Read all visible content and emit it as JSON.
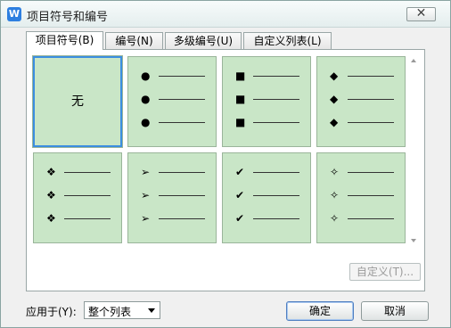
{
  "window": {
    "title": "项目符号和编号",
    "app_icon": "W",
    "close_glyph": "✕"
  },
  "tabs": [
    {
      "label": "项目符号(B)",
      "active": true
    },
    {
      "label": "编号(N)",
      "active": false
    },
    {
      "label": "多级编号(U)",
      "active": false
    },
    {
      "label": "自定义列表(L)",
      "active": false
    }
  ],
  "bullets": {
    "none_label": "无",
    "tile_color": "#c9e6c7",
    "selected_color": "#3b8ee0",
    "styles": [
      {
        "icon": "none",
        "glyph": "",
        "selected": true
      },
      {
        "icon": "filled-circle-icon",
        "glyph": "●"
      },
      {
        "icon": "filled-square-icon",
        "glyph": "■"
      },
      {
        "icon": "filled-diamond-icon",
        "glyph": "◆"
      },
      {
        "icon": "four-diamond-icon",
        "glyph": "❖"
      },
      {
        "icon": "arrowhead-icon",
        "glyph": "➢"
      },
      {
        "icon": "checkmark-icon",
        "glyph": "✔"
      },
      {
        "icon": "four-point-star-icon",
        "glyph": "✧"
      }
    ]
  },
  "custom_button": "自定义(T)...",
  "apply": {
    "label": "应用于(Y):",
    "value": "整个列表"
  },
  "buttons": {
    "ok": "确定",
    "cancel": "取消"
  }
}
